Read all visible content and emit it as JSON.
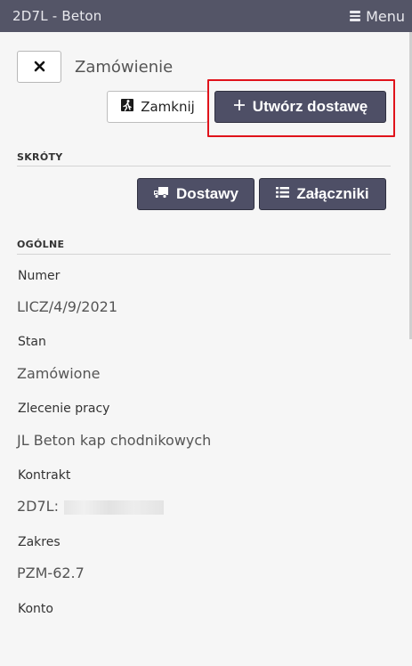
{
  "header": {
    "app_title": "2D7L - Beton",
    "menu_label": "Menu"
  },
  "page": {
    "title": "Zamówienie"
  },
  "actions": {
    "close_label": "Zamknij",
    "create_delivery_label": "Utwórz dostawę"
  },
  "shortcuts": {
    "heading": "SKRÓTY",
    "deliveries_label": "Dostawy",
    "attachments_label": "Załączniki"
  },
  "general": {
    "heading": "OGÓLNE",
    "fields": [
      {
        "label": "Numer",
        "value": "LICZ/4/9/2021"
      },
      {
        "label": "Stan",
        "value": "Zamówione"
      },
      {
        "label": "Zlecenie pracy",
        "value": "JL Beton kap chodnikowych"
      },
      {
        "label": "Kontrakt",
        "value": "2D7L:"
      },
      {
        "label": "Zakres",
        "value": "PZM-62.7"
      },
      {
        "label": "Konto",
        "value": ""
      }
    ]
  },
  "colors": {
    "topbar": "#545567",
    "button_dark": "#4e4f66",
    "highlight": "#e0131b",
    "background": "#f6f6f6"
  },
  "icons": {
    "menu": "hamburger-icon",
    "close": "x-icon",
    "exit": "running-exit-icon",
    "add": "plus-icon",
    "truck": "truck-icon",
    "list": "list-icon"
  }
}
